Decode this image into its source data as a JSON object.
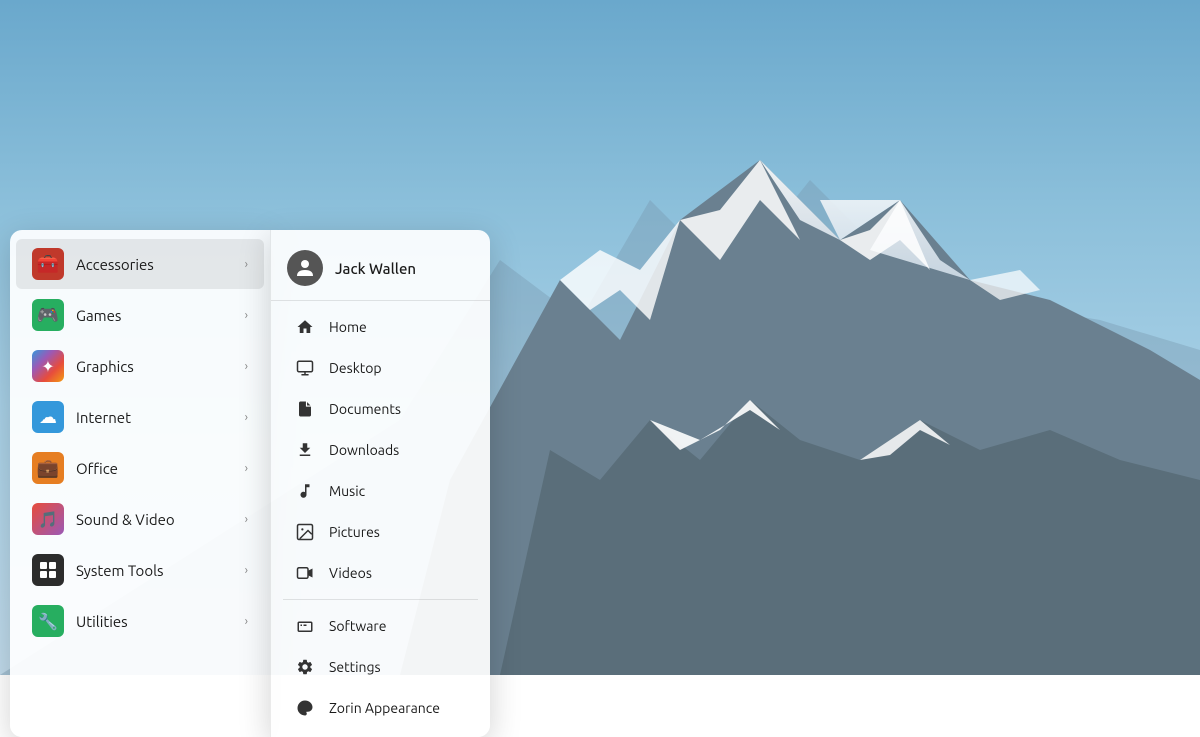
{
  "desktop": {
    "background": "mountain-sky"
  },
  "left_panel": {
    "items": [
      {
        "id": "accessories",
        "label": "Accessories",
        "icon_type": "accessories",
        "has_arrow": true,
        "active": true
      },
      {
        "id": "games",
        "label": "Games",
        "icon_type": "games",
        "has_arrow": true,
        "active": false
      },
      {
        "id": "graphics",
        "label": "Graphics",
        "icon_type": "graphics",
        "has_arrow": true,
        "active": false
      },
      {
        "id": "internet",
        "label": "Internet",
        "icon_type": "internet",
        "has_arrow": true,
        "active": false
      },
      {
        "id": "office",
        "label": "Office",
        "icon_type": "office",
        "has_arrow": true,
        "active": false
      },
      {
        "id": "sound-video",
        "label": "Sound & Video",
        "icon_type": "sound",
        "has_arrow": true,
        "active": false
      },
      {
        "id": "system-tools",
        "label": "System Tools",
        "icon_type": "system",
        "has_arrow": true,
        "active": false
      },
      {
        "id": "utilities",
        "label": "Utilities",
        "icon_type": "utilities",
        "has_arrow": true,
        "active": false
      }
    ]
  },
  "right_panel": {
    "user": {
      "name": "Jack Wallen"
    },
    "places": [
      {
        "id": "home",
        "label": "Home",
        "icon": "🏠"
      },
      {
        "id": "desktop",
        "label": "Desktop",
        "icon": "🖥"
      },
      {
        "id": "documents",
        "label": "Documents",
        "icon": "📄"
      },
      {
        "id": "downloads",
        "label": "Downloads",
        "icon": "⬇"
      },
      {
        "id": "music",
        "label": "Music",
        "icon": "🎵"
      },
      {
        "id": "pictures",
        "label": "Pictures",
        "icon": "🖼"
      },
      {
        "id": "videos",
        "label": "Videos",
        "icon": "🎬"
      }
    ],
    "system": [
      {
        "id": "software",
        "label": "Software",
        "icon": "🧳"
      },
      {
        "id": "settings",
        "label": "Settings",
        "icon": "⚙"
      },
      {
        "id": "zorin-appearance",
        "label": "Zorin Appearance",
        "icon": "🎨"
      }
    ]
  },
  "arrow_char": "›"
}
